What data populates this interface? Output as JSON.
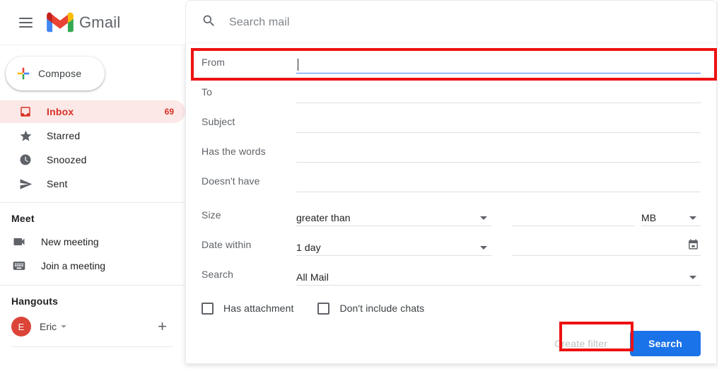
{
  "app": {
    "name": "Gmail",
    "menu_icon": "hamburger-menu-icon",
    "logo_icon": "gmail-m-logo"
  },
  "compose": {
    "label": "Compose",
    "icon": "plus-icon"
  },
  "sidebar": {
    "items": [
      {
        "label": "Inbox",
        "icon": "inbox-icon",
        "count": "69",
        "active": true
      },
      {
        "label": "Starred",
        "icon": "star-icon",
        "count": "",
        "active": false
      },
      {
        "label": "Snoozed",
        "icon": "clock-icon",
        "count": "",
        "active": false
      },
      {
        "label": "Sent",
        "icon": "send-icon",
        "count": "",
        "active": false
      }
    ],
    "meet": {
      "title": "Meet",
      "items": [
        {
          "label": "New meeting",
          "icon": "video-camera-icon"
        },
        {
          "label": "Join a meeting",
          "icon": "keyboard-icon"
        }
      ]
    },
    "hangouts": {
      "title": "Hangouts",
      "user": "Eric",
      "avatar_initial": "E",
      "add_icon": "plus-icon"
    }
  },
  "search": {
    "placeholder": "Search mail",
    "icon": "search-icon"
  },
  "filter_form": {
    "fields": [
      {
        "label": "From",
        "value": "",
        "focused": true
      },
      {
        "label": "To",
        "value": "",
        "focused": false
      },
      {
        "label": "Subject",
        "value": "",
        "focused": false
      },
      {
        "label": "Has the words",
        "value": "",
        "focused": false
      },
      {
        "label": "Doesn't have",
        "value": "",
        "focused": false
      }
    ],
    "size": {
      "label": "Size",
      "comparator": "greater than",
      "amount": "",
      "unit": "MB"
    },
    "date_within": {
      "label": "Date within",
      "range": "1 day",
      "date": "",
      "calendar_icon": "calendar-icon"
    },
    "scope": {
      "label": "Search",
      "value": "All Mail"
    },
    "checkboxes": [
      {
        "label": "Has attachment",
        "checked": false
      },
      {
        "label": "Don't include chats",
        "checked": false
      }
    ],
    "create_filter_label": "Create filter",
    "search_button_label": "Search"
  },
  "colors": {
    "accent_blue": "#1a73e8",
    "gmail_red": "#d93025",
    "annotation_red": "#ee1111",
    "focus_underline": "#4285f4"
  }
}
